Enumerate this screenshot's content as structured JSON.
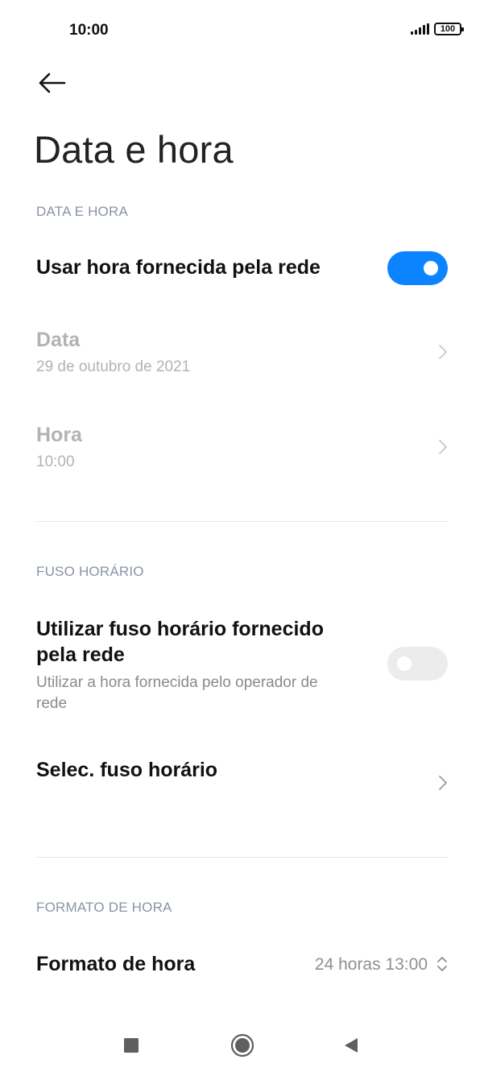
{
  "status_bar": {
    "time": "10:00",
    "battery": "100"
  },
  "page": {
    "title": "Data e hora"
  },
  "sections": {
    "date_time": {
      "header": "DATA E HORA",
      "use_network_time": {
        "label": "Usar hora fornecida pela rede",
        "enabled": true
      },
      "date": {
        "label": "Data",
        "value": "29 de outubro de 2021"
      },
      "time": {
        "label": "Hora",
        "value": "10:00"
      }
    },
    "timezone": {
      "header": "FUSO HORÁRIO",
      "use_network_timezone": {
        "label_line1": "Utilizar fuso horário fornecido",
        "label_line2": "pela rede",
        "sub_line1": "Utilizar a hora fornecida pelo operador de",
        "sub_line2": "rede",
        "enabled": false
      },
      "select_timezone": {
        "label": "Selec. fuso horário"
      }
    },
    "time_format": {
      "header": "FORMATO DE HORA",
      "format": {
        "label": "Formato de hora",
        "value": "24 horas 13:00"
      }
    }
  },
  "colors": {
    "accent": "#0d84ff",
    "section_header": "#8a93a8",
    "disabled_text": "#b3b3b3",
    "toggle_off": "#ececec"
  },
  "icons": {
    "back": "arrow-left-icon",
    "chevron": "chevron-right-icon",
    "updown": "chevron-up-down-icon",
    "nav_recents": "square-icon",
    "nav_home": "circle-icon",
    "nav_back": "triangle-left-icon"
  }
}
